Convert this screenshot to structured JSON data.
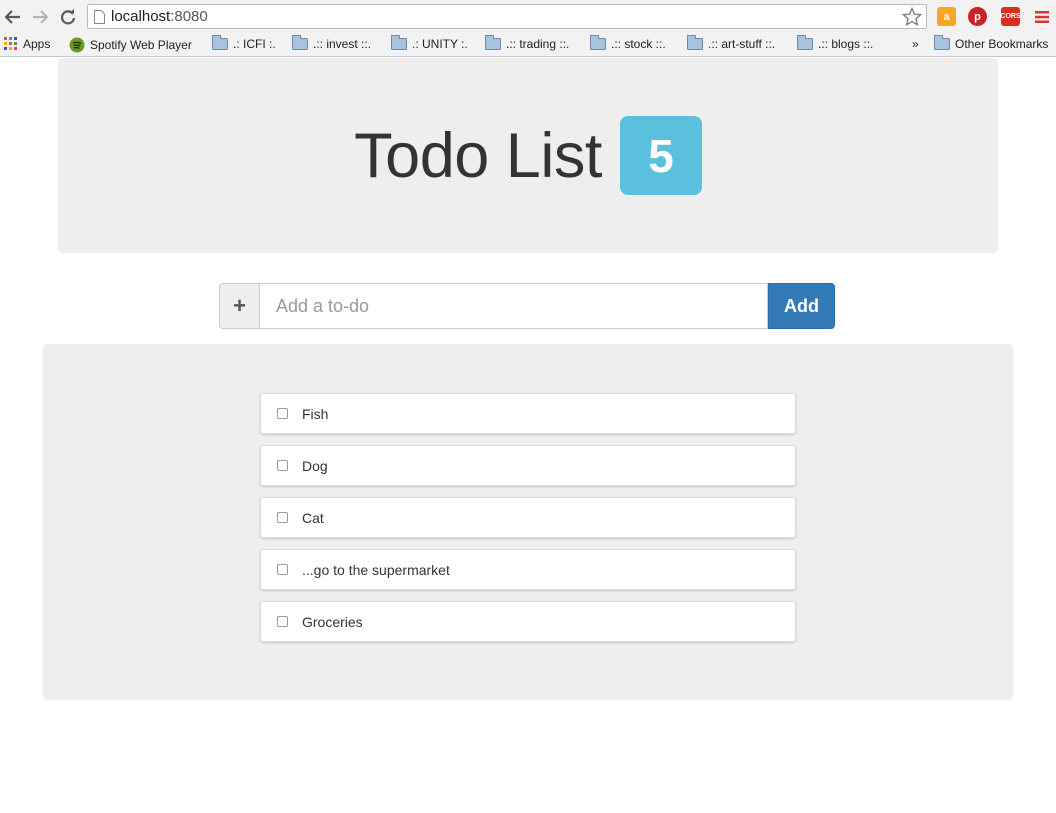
{
  "browser": {
    "url_host": "localhost",
    "url_port": ":8080",
    "bookmarks": [
      {
        "label": "Apps",
        "type": "apps"
      },
      {
        "label": "Spotify Web Player",
        "type": "spotify"
      },
      {
        "label": ".: ICFI :.",
        "type": "folder"
      },
      {
        "label": ".:: invest ::.",
        "type": "folder"
      },
      {
        "label": ".: UNITY :.",
        "type": "folder"
      },
      {
        "label": ".:: trading ::.",
        "type": "folder"
      },
      {
        "label": ".:: stock ::.",
        "type": "folder"
      },
      {
        "label": ".:: art-stuff ::.",
        "type": "folder"
      },
      {
        "label": ".:: blogs ::.",
        "type": "folder"
      }
    ],
    "overflow": "»",
    "other_bookmarks": "Other Bookmarks",
    "ext_cors": "CORS"
  },
  "header": {
    "title": "Todo List",
    "count": "5",
    "badge_color": "#5bc0de"
  },
  "new_todo": {
    "addon": "+",
    "placeholder": "Add a to-do",
    "button_label": "Add",
    "button_color": "#337ab7"
  },
  "todos": [
    {
      "label": "Fish",
      "done": false
    },
    {
      "label": "Dog",
      "done": false
    },
    {
      "label": "Cat",
      "done": false
    },
    {
      "label": "...go to the supermarket",
      "done": false
    },
    {
      "label": "Groceries",
      "done": false
    }
  ]
}
